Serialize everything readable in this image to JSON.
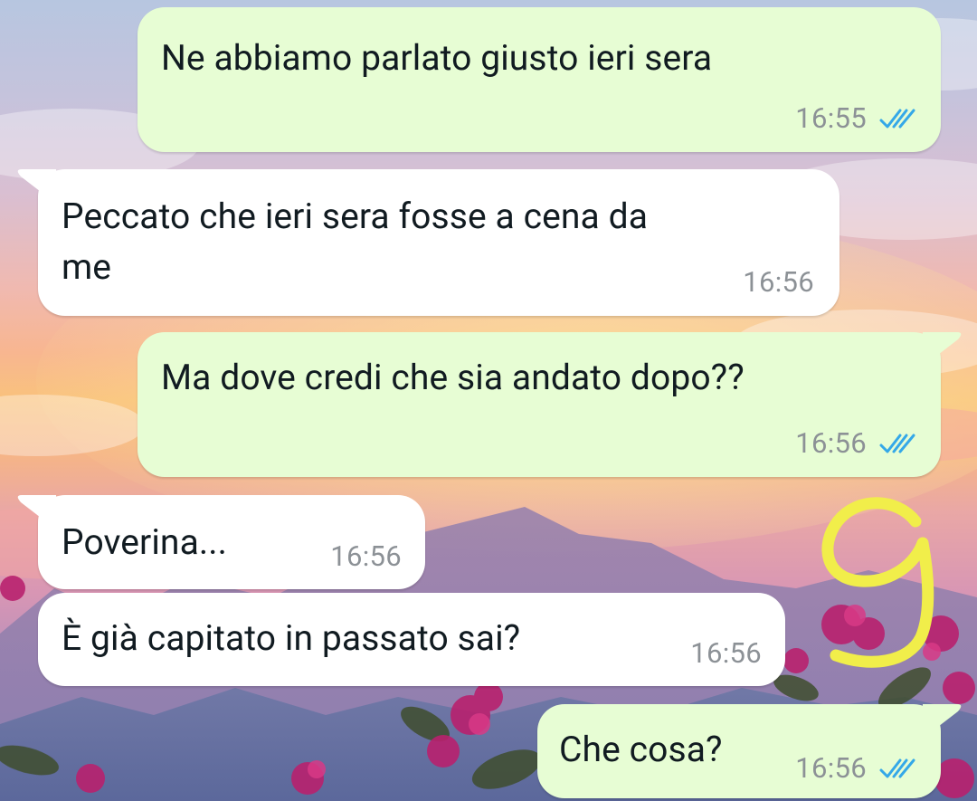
{
  "colors": {
    "outgoing_bubble": "#e7fdd4",
    "incoming_bubble": "#ffffff",
    "read_ticks": "#34a8e8",
    "annotation": "#f1ee4a",
    "timestamp": "#8c9196"
  },
  "messages": [
    {
      "direction": "out",
      "text": "Ne abbiamo parlato giusto ieri sera",
      "time": "16:55",
      "status_icon": "double-check-icon"
    },
    {
      "direction": "in",
      "text": "Peccato che ieri sera fosse a cena da\nme",
      "time": "16:56"
    },
    {
      "direction": "out",
      "text": "Ma dove credi che sia andato dopo??",
      "time": "16:56",
      "status_icon": "double-check-icon"
    },
    {
      "direction": "in",
      "text": "Poverina...",
      "time": "16:56"
    },
    {
      "direction": "in",
      "text": "È già capitato in passato sai?",
      "time": "16:56"
    },
    {
      "direction": "out",
      "text": "Che cosa?",
      "time": "16:56",
      "status_icon": "double-check-icon"
    }
  ],
  "annotation": {
    "text": "9"
  }
}
